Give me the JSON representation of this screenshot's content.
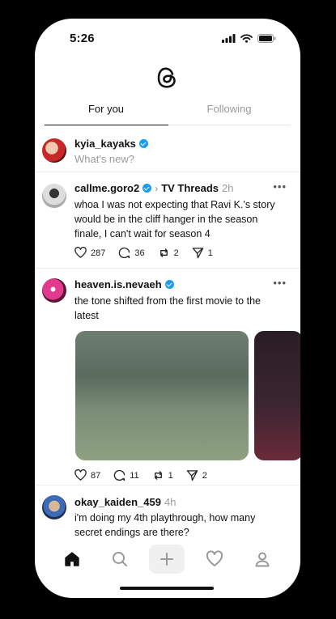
{
  "status": {
    "time": "5:26"
  },
  "tabs": [
    {
      "label": "For you",
      "active": true
    },
    {
      "label": "Following",
      "active": false
    }
  ],
  "composer": {
    "username": "kyia_kayaks",
    "prompt": "What's new?"
  },
  "posts": [
    {
      "username": "callme.goro2",
      "verified": true,
      "thread": "TV Threads",
      "time": "2h",
      "text": "whoa I was not expecting that Ravi K.'s story would be in the cliff hanger in the season finale, I can't wait for season 4",
      "likes": "287",
      "replies": "36",
      "reposts": "2",
      "shares": "1"
    },
    {
      "username": "heaven.is.nevaeh",
      "verified": true,
      "text": "the tone shifted from the first movie to the latest",
      "likes": "87",
      "replies": "11",
      "reposts": "1",
      "shares": "2"
    },
    {
      "username": "okay_kaiden_459",
      "time": "4h",
      "text": "i'm doing my 4th playthrough, how many secret endings are there?"
    }
  ],
  "nav": {
    "items": [
      "home-icon",
      "search-icon",
      "plus-icon",
      "heart-icon",
      "profile-icon"
    ]
  },
  "colors": {
    "accent": "#1d9bf0",
    "text": "#111111",
    "muted": "#9a9a9a"
  }
}
